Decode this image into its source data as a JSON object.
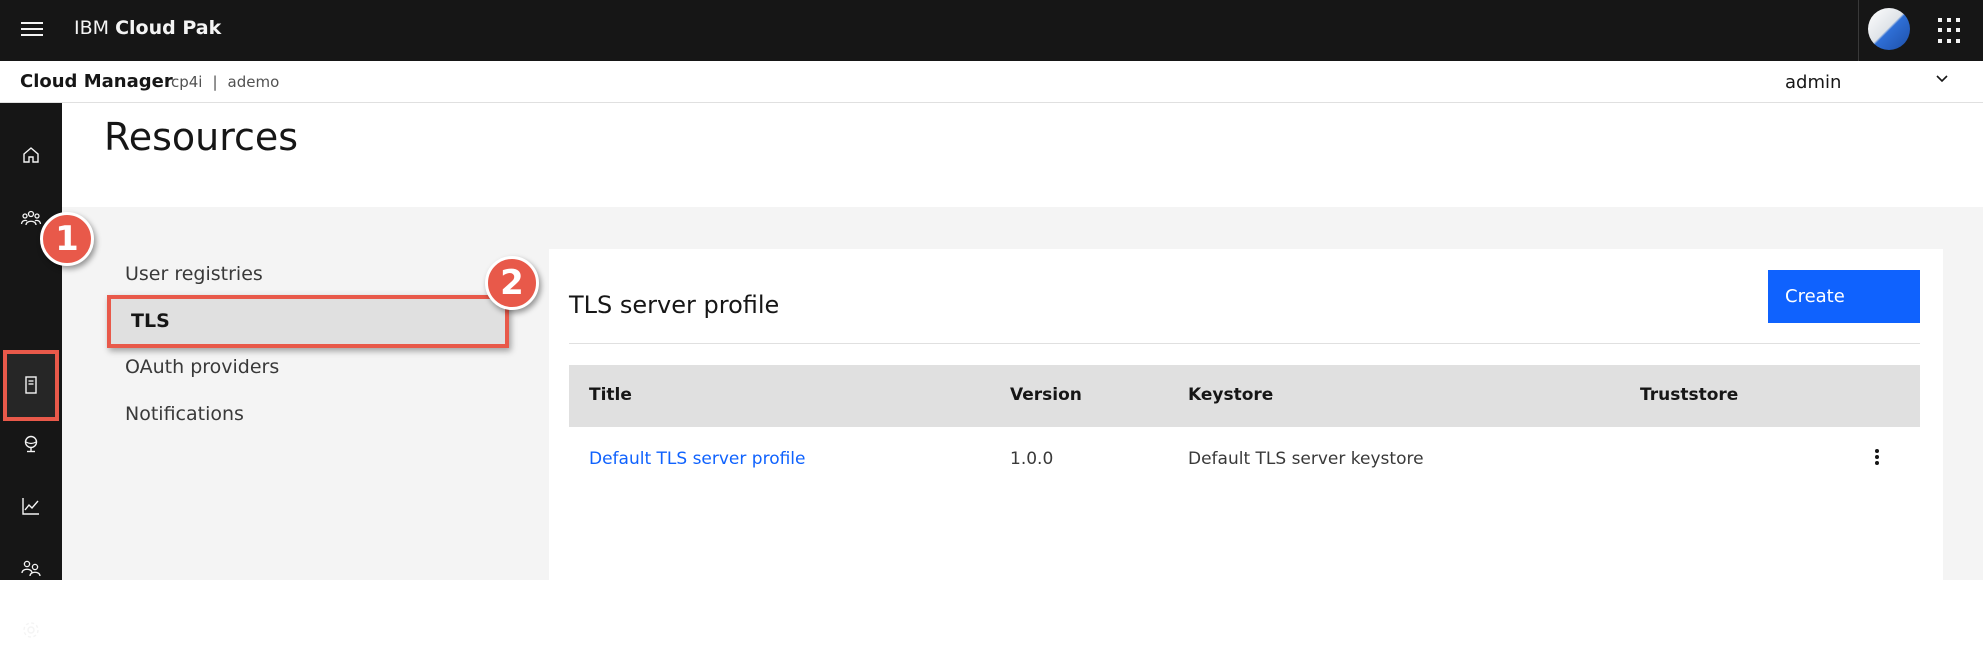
{
  "header": {
    "brand_prefix": "IBM",
    "brand_product": "Cloud Pak"
  },
  "subheader": {
    "app_name": "Cloud Manager",
    "breadcrumb": [
      "cp4i",
      "ademo"
    ],
    "breadcrumb_separator": "|",
    "user": "admin"
  },
  "sidenav": {
    "items": [
      {
        "icon": "home-icon"
      },
      {
        "icon": "users-group-icon"
      },
      {
        "icon": "resources-icon",
        "highlighted": true
      },
      {
        "icon": "topology-icon"
      },
      {
        "icon": "analytics-icon"
      },
      {
        "icon": "members-icon"
      },
      {
        "icon": "settings-icon"
      }
    ]
  },
  "page": {
    "title": "Resources"
  },
  "resource_menu": {
    "items": [
      "User registries",
      "TLS",
      "OAuth providers",
      "Notifications"
    ],
    "selected": "TLS"
  },
  "annotations": {
    "step1": "1",
    "step2": "2",
    "color": "#e8594a"
  },
  "panel": {
    "title": "TLS server profile",
    "create_label": "Create",
    "columns": [
      "Title",
      "Version",
      "Keystore",
      "Truststore"
    ],
    "rows": [
      {
        "title": "Default TLS server profile",
        "version": "1.0.0",
        "keystore": "Default TLS server keystore",
        "truststore": ""
      }
    ]
  },
  "colors": {
    "accent": "#0f62fe",
    "topbar": "#161616",
    "highlight": "#e8594a"
  }
}
